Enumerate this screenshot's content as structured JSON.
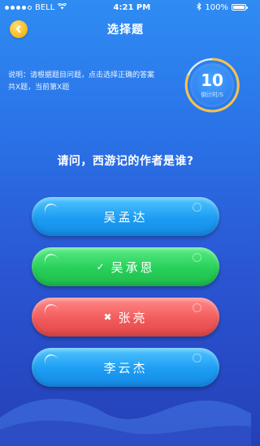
{
  "status_bar": {
    "carrier": "BELL",
    "time": "4:21 PM",
    "battery": "100%",
    "icons": [
      "signal-dots-icon",
      "wifi-icon",
      "bluetooth-icon",
      "battery-icon"
    ]
  },
  "nav": {
    "title": "选择题",
    "back_icon": "chevron-left-icon"
  },
  "description": {
    "line1": "说明：请根据题目问题，点击选择正确的答案",
    "line2": "共X题，当前第X题"
  },
  "timer": {
    "value": "10",
    "label": "倒计时/S"
  },
  "question": "请问，西游记的作者是谁?",
  "options": [
    {
      "label": "吴孟达",
      "state": "normal",
      "color": "#1c9cf3"
    },
    {
      "label": "吴承恩",
      "state": "correct",
      "mark": "✓",
      "color": "#27cf59"
    },
    {
      "label": "张亮",
      "state": "wrong",
      "mark": "✖",
      "color": "#f25b5b"
    },
    {
      "label": "李云杰",
      "state": "normal",
      "color": "#1c9cf3"
    }
  ]
}
